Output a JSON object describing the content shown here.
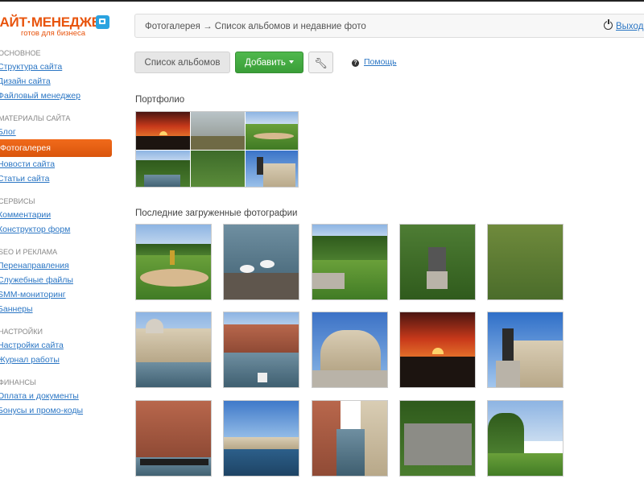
{
  "logo": {
    "title": "САЙТ·МЕНЕДЖЕР",
    "subtitle": "готов для бизнеса"
  },
  "sidebar": {
    "sections": [
      {
        "title": "Основное",
        "items": [
          "Структура сайта",
          "Дизайн сайта",
          "Файловый менеджер"
        ]
      },
      {
        "title": "Материалы сайта",
        "items": [
          "Блог",
          "Фотогалерея",
          "Новости сайта",
          "Статьи сайта"
        ]
      },
      {
        "title": "Сервисы",
        "items": [
          "Комментарии",
          "Конструктор форм"
        ]
      },
      {
        "title": "SEO и реклама",
        "items": [
          "Перенаправления",
          "Служебные файлы",
          "SMM-мониторинг",
          "Баннеры"
        ]
      },
      {
        "title": "Настройки",
        "items": [
          "Настройки сайта",
          "Журнал работы"
        ]
      },
      {
        "title": "Финансы",
        "items": [
          "Оплата и документы",
          "Бонусы и промо-коды"
        ]
      }
    ],
    "active": "Фотогалерея"
  },
  "header": {
    "breadcrumb": "Фотогалерея → Список альбомов и недавние фото",
    "logout_label": "Выход"
  },
  "toolbar": {
    "albums_label": "Список альбомов",
    "add_label": "Добавить",
    "help_label": "Помощь"
  },
  "album_section": {
    "title": "Портфолио"
  },
  "recent_section": {
    "title": "Последние загруженные фотографии"
  },
  "colors": {
    "accent": "#e8540d",
    "add_button": "#3a9e38",
    "link": "#2b76c4"
  }
}
